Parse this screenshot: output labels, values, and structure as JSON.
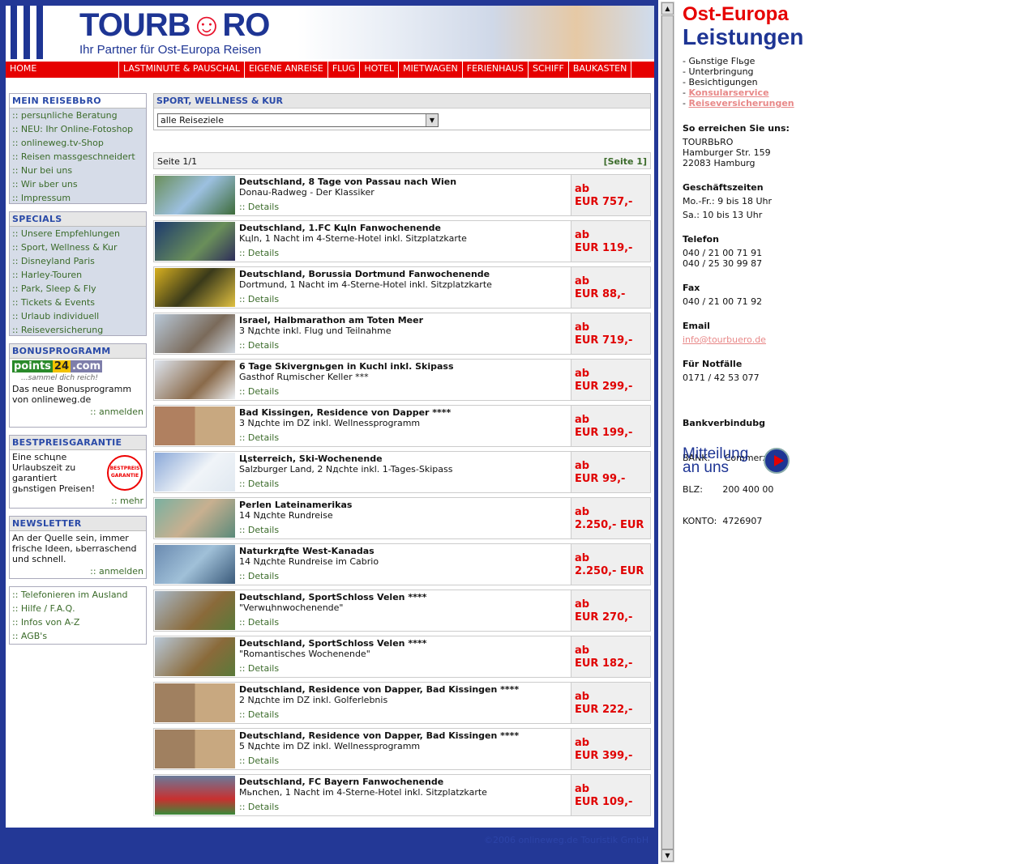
{
  "header": {
    "logo": "TOURB",
    "logo_smile": "☺",
    "logo_end": "RO",
    "tagline": "Ihr Partner für Ost-Europa Reisen"
  },
  "nav": [
    "HOME",
    "LASTMINUTE & PAUSCHAL",
    "EIGENE ANREISE",
    "FLUG",
    "HOTEL",
    "MIETWAGEN",
    "FERIENHAUS",
    "SCHIFF",
    "BAUKASTEN"
  ],
  "sidebar": {
    "mein": {
      "title": "MEIN REISEBЬRO",
      "items": [
        ":: persцnliche Beratung",
        ":: NEU: Ihr Online-Fotoshop",
        ":: onlineweg.tv-Shop",
        ":: Reisen massgeschneidert",
        ":: Nur bei uns",
        ":: Wir ьber uns",
        ":: Impressum"
      ]
    },
    "specials": {
      "title": "SPECIALS",
      "items": [
        ":: Unsere Empfehlungen",
        ":: Sport, Wellness & Kur",
        ":: Disneyland Paris",
        ":: Harley-Touren",
        ":: Park, Sleep & Fly",
        ":: Tickets & Events",
        ":: Urlaub individuell",
        ":: Reiseversicherung"
      ]
    },
    "bonus": {
      "title": "BONUSPROGRAMM",
      "logo_a": "points",
      "logo_b": "24",
      "logo_c": ".com",
      "slogan": "...sammel dich reich!",
      "text": "Das neue Bonusprogramm von onlineweg.de",
      "link": ":: anmelden"
    },
    "best": {
      "title": "BESTPREISGARANTIE",
      "text": "Eine schцne Urlaubszeit zu garantiert gьnstigen Preisen!",
      "badge": "BESTPREIS GARANTIE",
      "link": ":: mehr"
    },
    "news": {
      "title": "NEWSLETTER",
      "text": "An der Quelle sein, immer frische Ideen, ьberraschend und schnell.",
      "link": ":: anmelden"
    },
    "misc": {
      "items": [
        ":: Telefonieren im Ausland",
        ":: Hilfe / F.A.Q.",
        ":: Infos von A-Z",
        ":: AGB's"
      ]
    }
  },
  "main": {
    "section_title": "SPORT, WELLNESS & KUR",
    "select_value": "alle Reiseziele",
    "page_left": "Seite 1/1",
    "page_right": "[Seite 1]",
    "details_label": ":: Details",
    "offers": [
      {
        "title": "Deutschland, 8 Tage von Passau nach Wien",
        "sub": "Donau-Radweg - Der Klassiker",
        "pre": "ab",
        "price": "EUR 757,-"
      },
      {
        "title": "Deutschland, 1.FC Kцln Fanwochenende",
        "sub": "Kцln, 1 Nacht im 4-Sterne-Hotel inkl. Sitzplatzkarte",
        "pre": "ab",
        "price": "EUR 119,-"
      },
      {
        "title": "Deutschland, Borussia Dortmund Fanwochenende",
        "sub": "Dortmund, 1 Nacht im 4-Sterne-Hotel inkl. Sitzplatzkarte",
        "pre": "ab",
        "price": "EUR 88,-"
      },
      {
        "title": "Israel, Halbmarathon am Toten Meer",
        "sub": "3 Nдchte inkl. Flug und Teilnahme",
        "pre": "ab",
        "price": "EUR 719,-"
      },
      {
        "title": "6 Tage Skivergnьgen in Kuchl inkl. Skipass",
        "sub": "Gasthof Rцmischer Keller ***",
        "pre": "ab",
        "price": "EUR 299,-"
      },
      {
        "title": "Bad Kissingen, Residence von Dapper ****",
        "sub": "3 Nдchte im DZ inkl. Wellnessprogramm",
        "pre": "ab",
        "price": "EUR 199,-"
      },
      {
        "title": "Цsterreich, Ski-Wochenende",
        "sub": "Salzburger Land, 2 Nдchte inkl. 1-Tages-Skipass",
        "pre": "ab",
        "price": "EUR 99,-"
      },
      {
        "title": "Perlen Lateinamerikas",
        "sub": "14 Nдchte Rundreise",
        "pre": "ab",
        "price": "2.250,- EUR"
      },
      {
        "title": "Naturkrдfte West-Kanadas",
        "sub": "14 Nдchte Rundreise im Cabrio",
        "pre": "ab",
        "price": "2.250,- EUR"
      },
      {
        "title": "Deutschland, SportSchloss Velen ****",
        "sub": "\"Verwцhnwochenende\"",
        "pre": "ab",
        "price": "EUR 270,-"
      },
      {
        "title": "Deutschland, SportSchloss Velen ****",
        "sub": "\"Romantisches Wochenende\"",
        "pre": "ab",
        "price": "EUR 182,-"
      },
      {
        "title": "Deutschland, Residence von Dapper, Bad Kissingen ****",
        "sub": "2 Nдchte im DZ inkl. Golferlebnis",
        "pre": "ab",
        "price": "EUR 222,-"
      },
      {
        "title": "Deutschland, Residence von Dapper, Bad Kissingen ****",
        "sub": "5 Nдchte im DZ inkl. Wellnessprogramm",
        "pre": "ab",
        "price": "EUR 399,-"
      },
      {
        "title": "Deutschland, FC Bayern Fanwochenende",
        "sub": "Mьnchen, 1 Nacht im 4-Sterne-Hotel inkl. Sitzplatzkarte",
        "pre": "ab",
        "price": "EUR 109,-"
      }
    ],
    "copyright": "©2006 onlineweg.de Touristik GmbH"
  },
  "right": {
    "h1": "Ost-Europa",
    "h2": "Leistungen",
    "list": [
      "- Gьnstige Flьge",
      "- Unterbringung",
      "- Besichtigungen"
    ],
    "links": [
      "Konsularservice",
      "Reiseversicherungen"
    ],
    "reach": {
      "h": "So erreichen Sie uns:",
      "l1": "TOURBЬRO",
      "l2": "Hamburger Str. 159",
      "l3": "22083 Hamburg"
    },
    "hours": {
      "h": "Geschäftszeiten",
      "l1": "Mo.-Fr.: 9 bis 18 Uhr",
      "l2": "Sa.: 10 bis 13 Uhr"
    },
    "phone": {
      "h": "Telefon",
      "l1": "040 / 21 00 71 91",
      "l2": "040 / 25 30 99 87"
    },
    "fax": {
      "h": "Fax",
      "l1": "040 / 21 00 71 92"
    },
    "email": {
      "h": "Email",
      "l1": "info@tourbuero.de"
    },
    "notfall": {
      "h": "Für Notfälle",
      "l1": "0171 / 42 53 077"
    },
    "bank": {
      "h": "Bankverbindubg",
      "l1": "BANK:     Commerzbank",
      "l2": "BLZ:       200 400 00",
      "l3": "KONTO:  4726907"
    },
    "mitteilung": {
      "l1": "Mitteilung",
      "l2": "an uns"
    }
  },
  "colors": {
    "navy": "#233896",
    "red": "#e60000",
    "green": "#3b6b2a"
  }
}
